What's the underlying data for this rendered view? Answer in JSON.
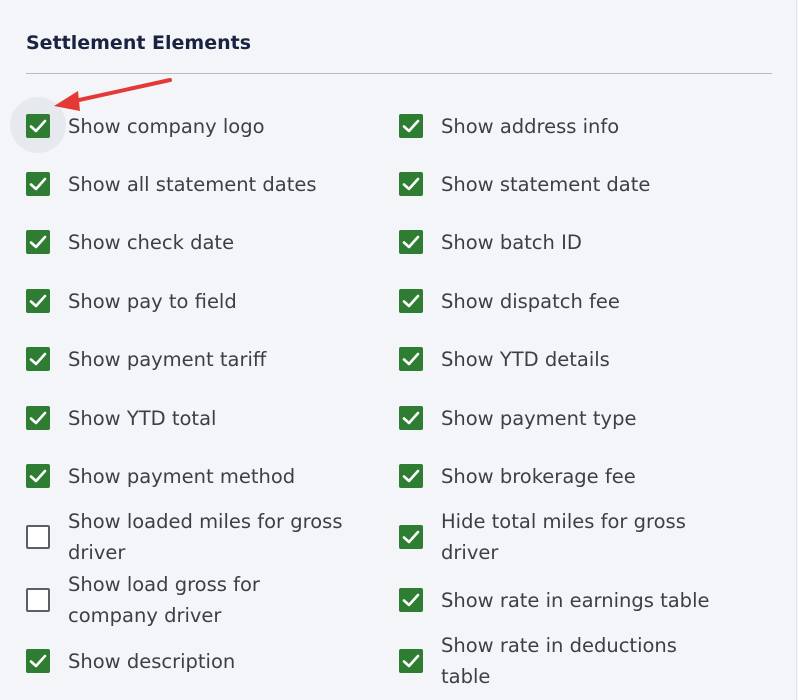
{
  "section": {
    "title": "Settlement Elements"
  },
  "colors": {
    "checked": "#2e7d32",
    "annotation_arrow": "#e53935"
  },
  "left_column": [
    {
      "label": "Show company logo",
      "checked": true
    },
    {
      "label": "Show all statement dates",
      "checked": true
    },
    {
      "label": "Show check date",
      "checked": true
    },
    {
      "label": "Show pay to field",
      "checked": true
    },
    {
      "label": "Show payment tariff",
      "checked": true
    },
    {
      "label": "Show YTD total",
      "checked": true
    },
    {
      "label": "Show payment method",
      "checked": true
    },
    {
      "label": "Show loaded miles for gross\ndriver",
      "checked": false
    },
    {
      "label": "Show load gross for\ncompany driver",
      "checked": false
    },
    {
      "label": "Show description",
      "checked": true
    }
  ],
  "right_column": [
    {
      "label": "Show address info",
      "checked": true
    },
    {
      "label": "Show statement date",
      "checked": true
    },
    {
      "label": "Show batch ID",
      "checked": true
    },
    {
      "label": "Show dispatch fee",
      "checked": true
    },
    {
      "label": "Show YTD details",
      "checked": true
    },
    {
      "label": "Show payment type",
      "checked": true
    },
    {
      "label": "Show brokerage fee",
      "checked": true
    },
    {
      "label": "Hide total miles for gross\ndriver",
      "checked": true
    },
    {
      "label": "Show rate in earnings table",
      "checked": true
    },
    {
      "label": "Show rate in deductions\ntable",
      "checked": true
    }
  ]
}
